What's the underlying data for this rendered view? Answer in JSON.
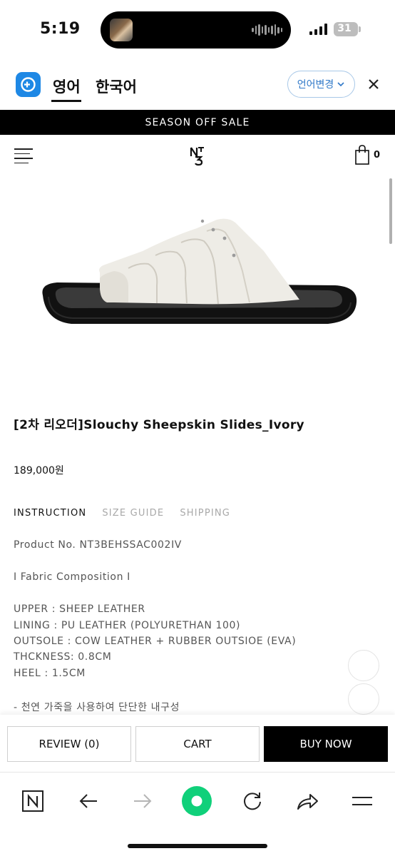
{
  "status_bar": {
    "time": "5:19",
    "battery": "31"
  },
  "lang_bar": {
    "tab_active": "영어",
    "tab_inactive": "한국어",
    "change_label": "언어변경"
  },
  "banner": {
    "text": "SEASON OFF SALE"
  },
  "header": {
    "logo_text": "N3",
    "cart_count": "0"
  },
  "product": {
    "title": "[2차 리오더]Slouchy Sheepskin Slides_Ivory",
    "price": "189,000원"
  },
  "tabs": [
    {
      "label": "INSTRUCTION",
      "active": true
    },
    {
      "label": "SIZE GUIDE",
      "active": false
    },
    {
      "label": "SHIPPING",
      "active": false
    }
  ],
  "description": {
    "product_no": "Product No. NT3BEHSSAC002IV",
    "composition_heading": "I Fabric Composition I",
    "lines": [
      "UPPER : SHEEP LEATHER",
      "LINING : PU LEATHER (POLYURETHAN 100)",
      "OUTSOLE : COW LEATHER + RUBBER OUTSIOE (EVA)",
      "THCKNESS: 0.8CM",
      "HEEL : 1.5CM"
    ],
    "note": "- 천연 가죽을 사용하여 단단한 내구성"
  },
  "actions": {
    "review": "REVIEW (0)",
    "cart": "CART",
    "buy_now": "BUY NOW"
  },
  "colors": {
    "accent_blue": "#1e88e5",
    "browser_green": "#10d07a",
    "banner_bg": "#000000"
  },
  "browser_nav_icons": [
    "naver-n-icon",
    "back-arrow-icon",
    "forward-arrow-icon",
    "green-dot-icon",
    "reload-icon",
    "share-icon",
    "menu-icon"
  ]
}
